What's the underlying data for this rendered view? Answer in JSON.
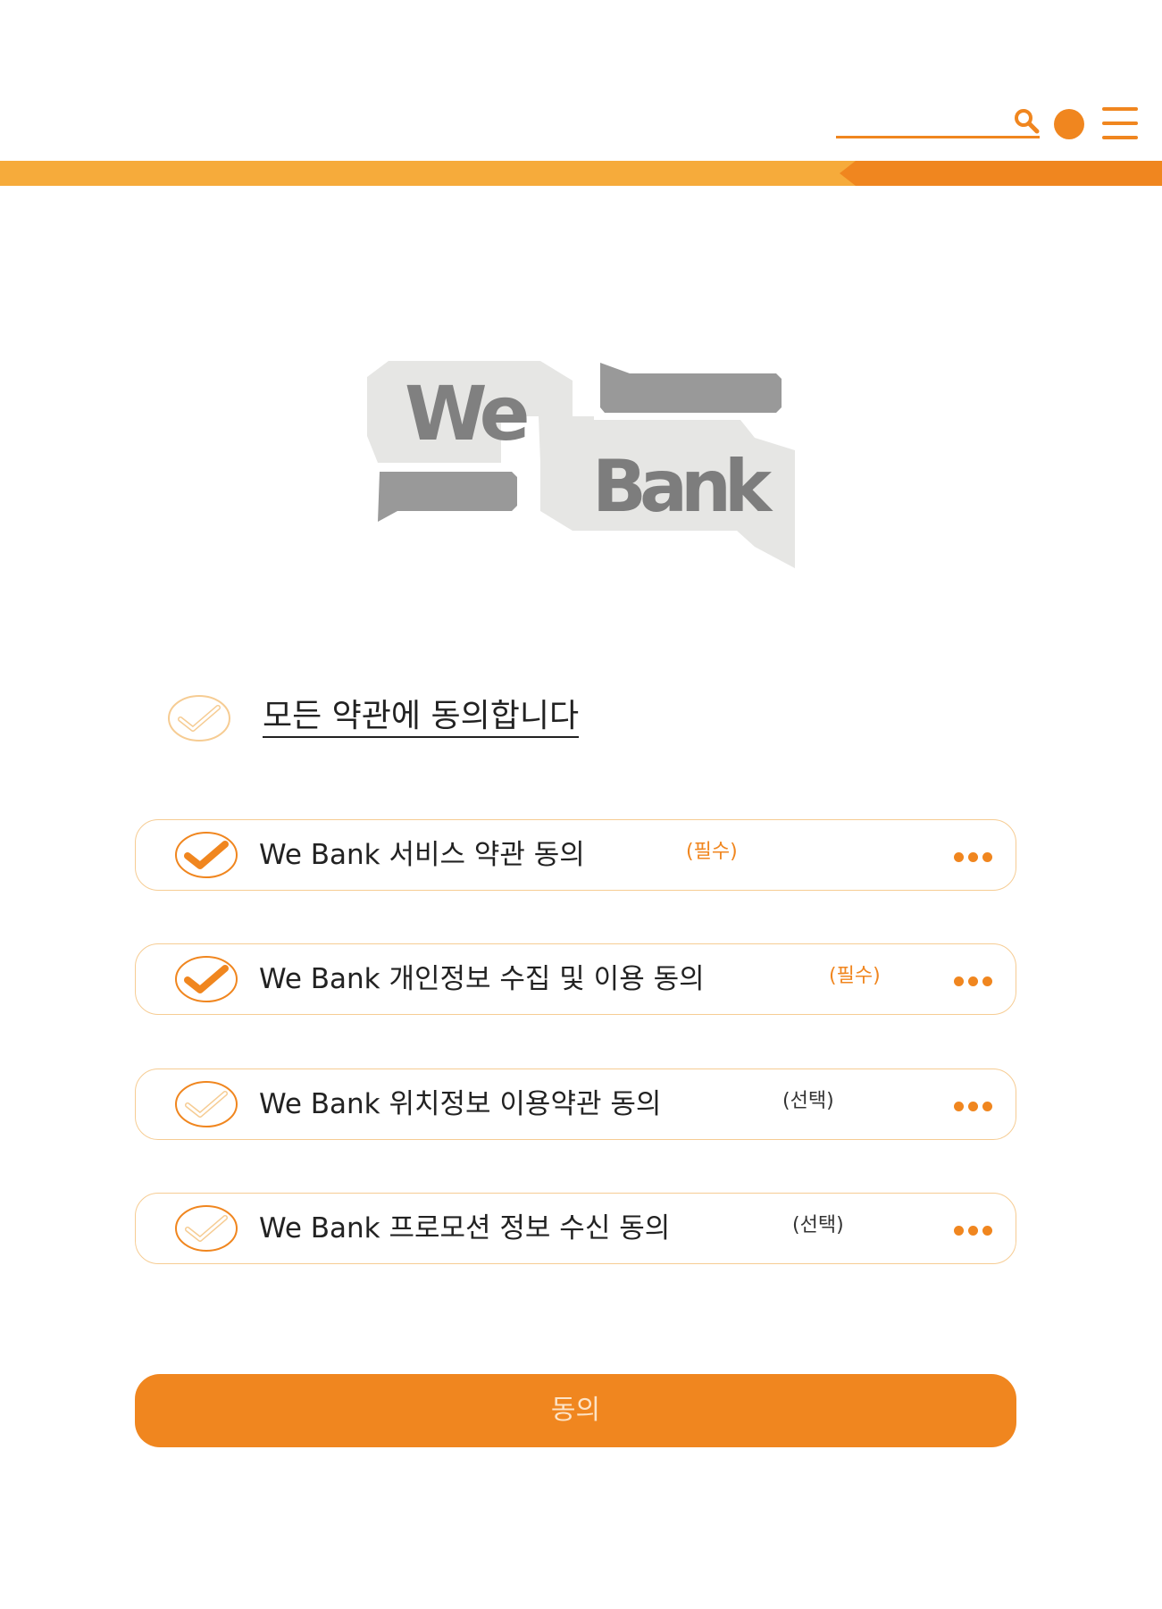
{
  "header": {
    "search_icon": "search-icon",
    "menu_icon": "hamburger-menu-icon",
    "accent_color": "#f0861f",
    "band_light_color": "#f6ab3b"
  },
  "logo": {
    "word_top": "We",
    "word_bottom": "Bank"
  },
  "agree_all": {
    "label": "모든 약관에 동의합니다",
    "checked": false
  },
  "terms": [
    {
      "label": "We Bank 서비스 약관 동의",
      "tag": "(필수)",
      "required": true,
      "checked": true
    },
    {
      "label": "We Bank 개인정보 수집 및 이용 동의",
      "tag": "(필수)",
      "required": true,
      "checked": true
    },
    {
      "label": "We Bank 위치정보 이용약관 동의",
      "tag": "(선택)",
      "required": false,
      "checked": false
    },
    {
      "label": "We Bank 프로모션 정보 수신 동의",
      "tag": "(선택)",
      "required": false,
      "checked": false
    }
  ],
  "submit": {
    "label": "동의"
  }
}
